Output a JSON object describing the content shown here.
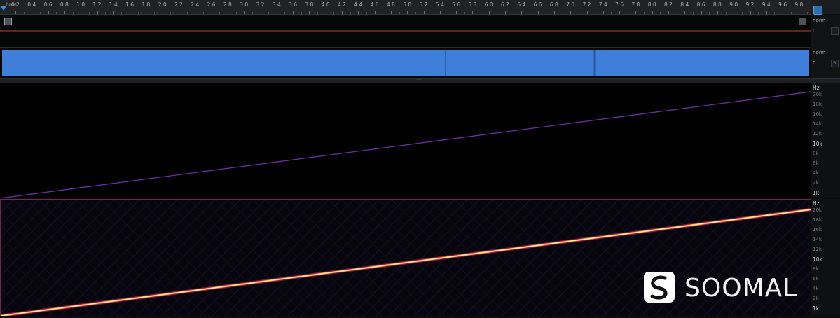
{
  "ruler": {
    "start_label": "hms",
    "labels": [
      "0.2",
      "0.4",
      "0.6",
      "0.8",
      "1.0",
      "1.2",
      "1.4",
      "1.6",
      "1.8",
      "2.0",
      "2.2",
      "2.4",
      "2.6",
      "2.8",
      "3.0",
      "3.2",
      "3.4",
      "3.6",
      "3.8",
      "4.0",
      "4.2",
      "4.4",
      "4.6",
      "4.8",
      "5.0",
      "5.2",
      "5.4",
      "5.6",
      "5.8",
      "6.0",
      "6.2",
      "6.4",
      "6.6",
      "6.8",
      "7.0",
      "7.2",
      "7.4",
      "7.6",
      "7.8",
      "8.0",
      "8.2",
      "8.4",
      "8.6",
      "8.8",
      "9.0",
      "9.2",
      "9.4",
      "9.6",
      "9.8"
    ]
  },
  "track1_scale": {
    "unit": "norm",
    "zero": "0",
    "box": "L"
  },
  "track2_scale": {
    "unit": "norm",
    "zero": "0",
    "box": "R"
  },
  "spec1_scale": {
    "unit": "Hz",
    "labels": [
      "20k",
      "18k",
      "16k",
      "14k",
      "12k",
      "10k",
      "8k",
      "6k",
      "4k",
      "2k",
      "1k"
    ],
    "highlight": [
      "10k",
      "1k"
    ]
  },
  "spec2_scale": {
    "unit": "Hz",
    "labels": [
      "20k",
      "18k",
      "16k",
      "14k",
      "12k",
      "10k",
      "8k",
      "6k",
      "4k",
      "2k",
      "1k"
    ],
    "highlight": [
      "10k",
      "1k"
    ]
  },
  "watermark": {
    "text": "SOOMAL"
  },
  "colors": {
    "waveform": "#3f7ed9",
    "spec1_sweep": "#6b2fa6",
    "spec2_sweep_core": "#fff2a8",
    "spec2_sweep_glow": "#d4267a",
    "cursor_line": "#b2402f"
  }
}
